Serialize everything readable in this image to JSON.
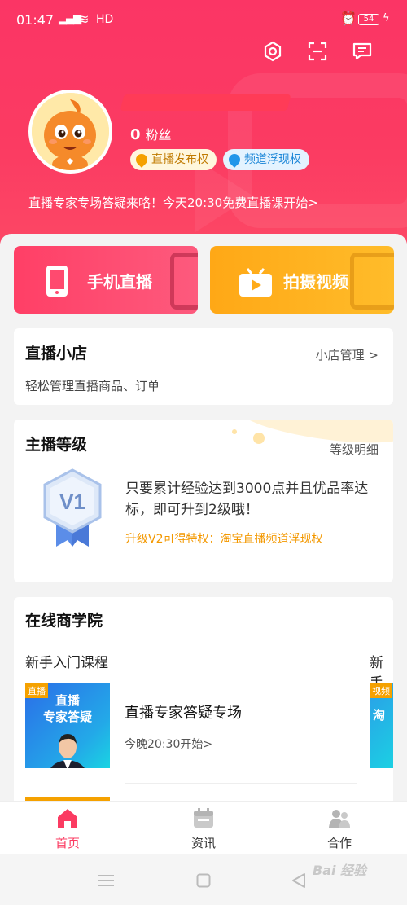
{
  "status_bar": {
    "time": "01:47",
    "signal": "4G",
    "network": "HD",
    "battery": "54"
  },
  "header": {
    "fans_count": "0",
    "fans_label": "粉丝",
    "badges": [
      "直播发布权",
      "频道浮现权"
    ],
    "notice": "直播专家专场答疑来咯！今天20:30免费直播课开始>"
  },
  "actions": {
    "live_label": "手机直播",
    "video_label": "拍摄视频"
  },
  "shop": {
    "title": "直播小店",
    "link": "小店管理 >",
    "desc": "轻松管理直播商品、订单"
  },
  "level": {
    "title": "主播等级",
    "link": "等级明细",
    "medal": "V1",
    "text": "只要累计经验达到3000点并且优品率达标，即可升到2级哦！",
    "perk": "升级V2可得特权：淘宝直播频道浮现权"
  },
  "school": {
    "title": "在线商学院",
    "categories": [
      "新手入门课程",
      "新手"
    ],
    "course": {
      "thumb_tag": "直播",
      "thumb_line1": "直播",
      "thumb_line2": "专家答疑",
      "title": "直播专家答疑专场",
      "time": "今晚20:30开始>"
    },
    "course2": {
      "thumb_tag": "视频",
      "thumb_line1": "淘"
    }
  },
  "tabs": [
    {
      "label": "首页",
      "icon": "home-icon",
      "active": true
    },
    {
      "label": "资讯",
      "icon": "news-icon",
      "active": false
    },
    {
      "label": "合作",
      "icon": "partners-icon",
      "active": false
    }
  ],
  "watermark": "Bai 经验",
  "colors": {
    "primary": "#fb3b62",
    "orange": "#ffab18",
    "perk": "#f39800"
  }
}
